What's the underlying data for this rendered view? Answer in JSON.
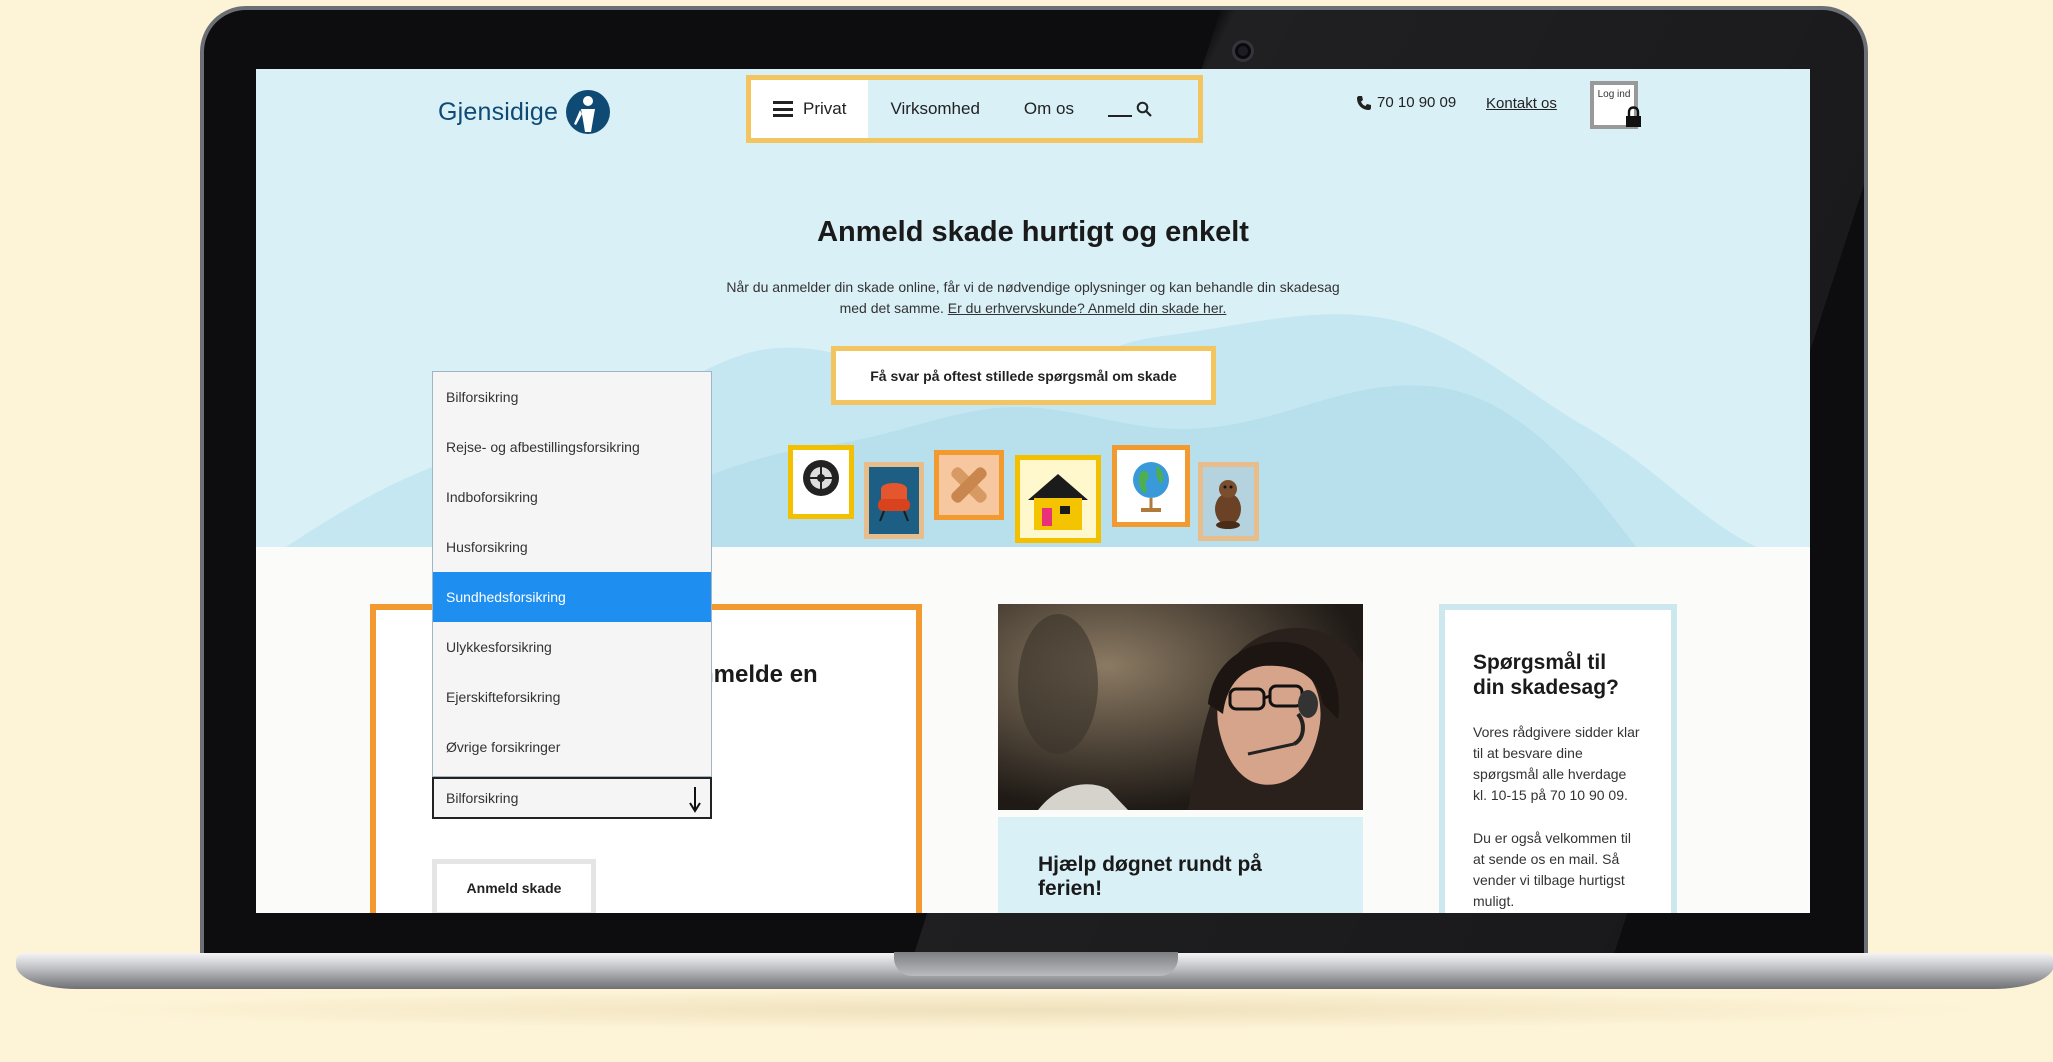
{
  "header": {
    "logo_text": "Gjensidige",
    "nav": [
      {
        "label": "Privat",
        "active": true
      },
      {
        "label": "Virksomhed",
        "active": false
      },
      {
        "label": "Om os",
        "active": false
      }
    ],
    "phone": "70 10 90 09",
    "contact_label": "Kontakt os",
    "login_label": "Log ind"
  },
  "hero": {
    "title": "Anmeld skade hurtigt og enkelt",
    "lead_text": "Når du anmelder din skade online, får vi de nødvendige oplysninger og kan behandle din skadesag med det samme.",
    "lead_link": "Er du erhvervskunde? Anmeld din skade her.",
    "faq_button": "Få svar på oftest stillede spørgsmål om skade",
    "icons": [
      "tire-icon",
      "armchair-icon",
      "bandage-icon",
      "house-icon",
      "globe-icon",
      "beaver-icon"
    ]
  },
  "dropdown": {
    "options": [
      "Bilforsikring",
      "Rejse- og afbestillingsforsikring",
      "Indboforsikring",
      "Husforsikring",
      "Sundhedsforsikring",
      "Ulykkesforsikring",
      "Ejerskifteforsikring",
      "Øvrige forsikringer"
    ],
    "highlighted": "Sundhedsforsikring",
    "selected_value": "Bilforsikring"
  },
  "claim_card": {
    "title_partial": "nmelde en",
    "button": "Anmeld skade"
  },
  "promo_card": {
    "title": "Hjælp døgnet rundt på ferien!"
  },
  "side_card": {
    "title": "Spørgsmål til din skadesag?",
    "p1": "Vores rådgivere sidder klar til at besvare dine spørgsmål alle hverdage kl. 10-15 på 70 10 90 09.",
    "p2": "Du er også velkommen til at sende os en mail. Så vender vi tilbage hurtigst muligt."
  },
  "colors": {
    "brand_blue": "#0f4a75",
    "hero_bg": "#d9f0f7",
    "accent_yellow": "#f3c560",
    "accent_orange": "#f29a30",
    "select_highlight": "#1e8ff0"
  }
}
